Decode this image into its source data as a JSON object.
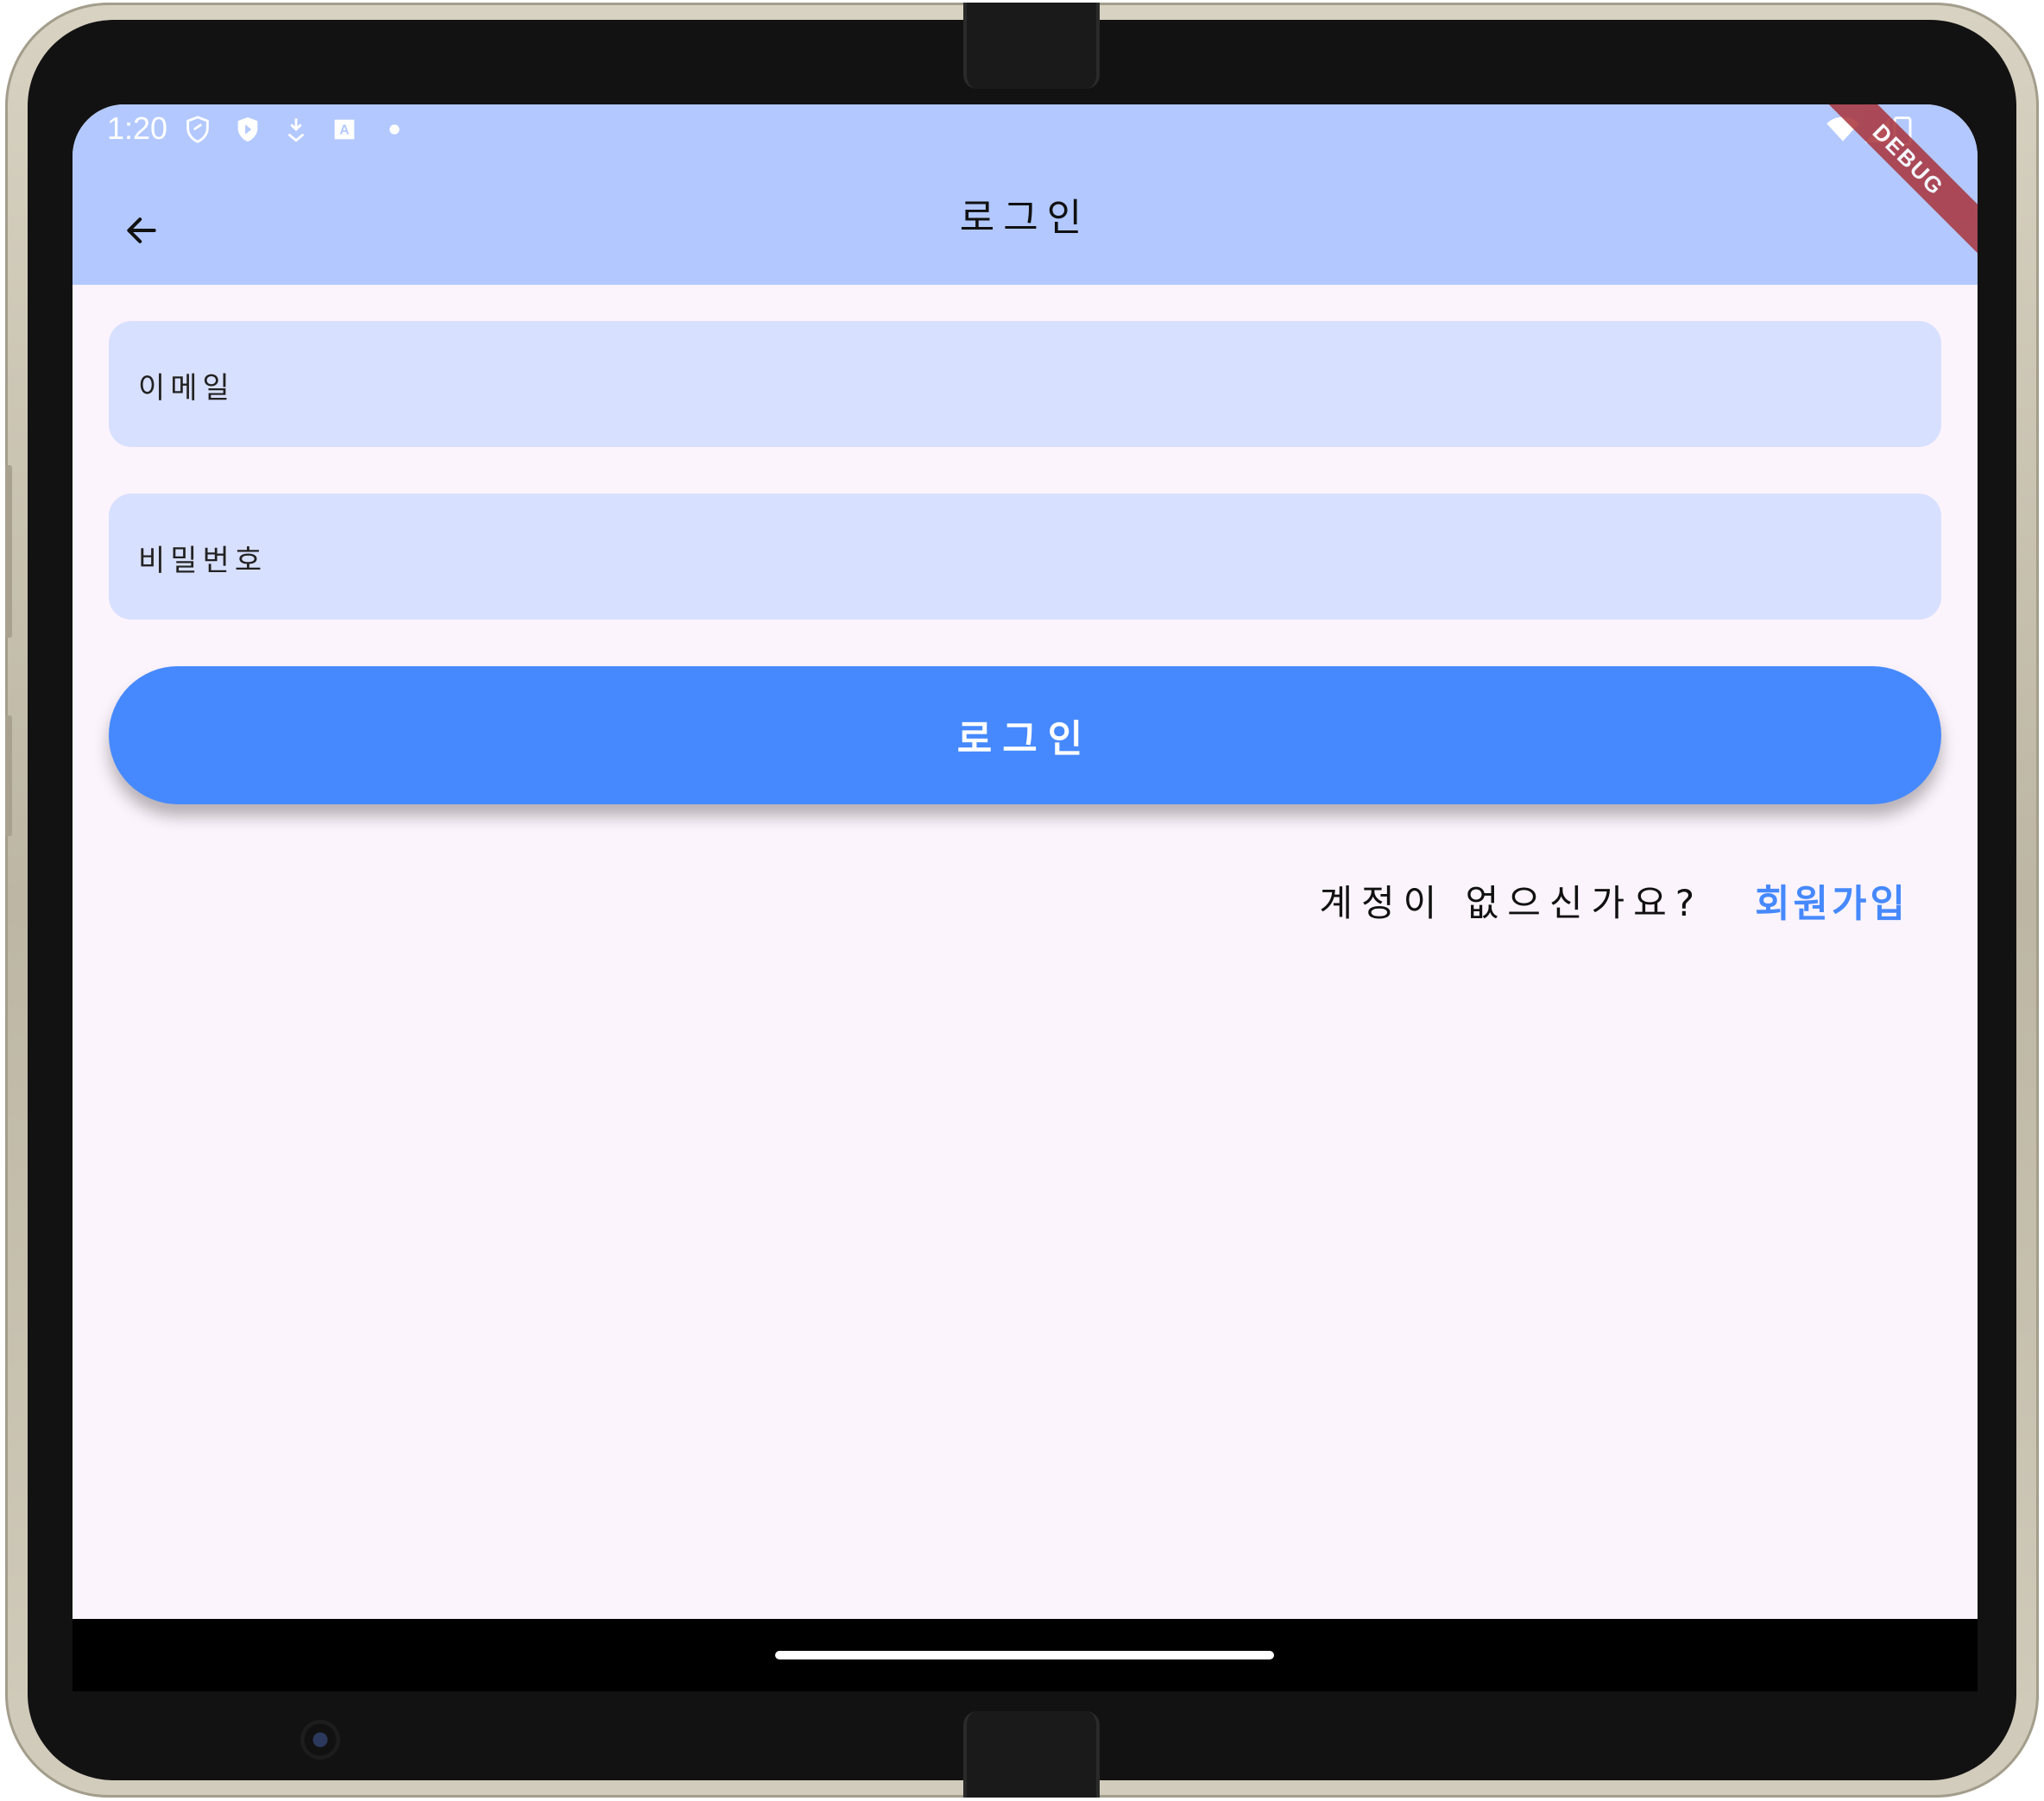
{
  "status_bar": {
    "time": "1:20",
    "icons_left": [
      "shield-icon",
      "play-protect-icon",
      "download-icon",
      "keyboard-icon",
      "dot-icon"
    ],
    "icons_right": [
      "wifi-icon",
      "signal-icon",
      "battery-icon"
    ]
  },
  "app_bar": {
    "title": "로그인",
    "back_icon": "arrow-back-icon",
    "color": "#b2c8ff"
  },
  "debug_banner": "DEBUG",
  "form": {
    "email_label": "이메일",
    "password_label": "비밀번호",
    "login_button": "로그인",
    "field_color": "#d8e0ff",
    "button_color": "#4689fe"
  },
  "signup": {
    "question": "계정이 없으신가요?",
    "link": "회원가입"
  },
  "background": "#fcf4fc"
}
